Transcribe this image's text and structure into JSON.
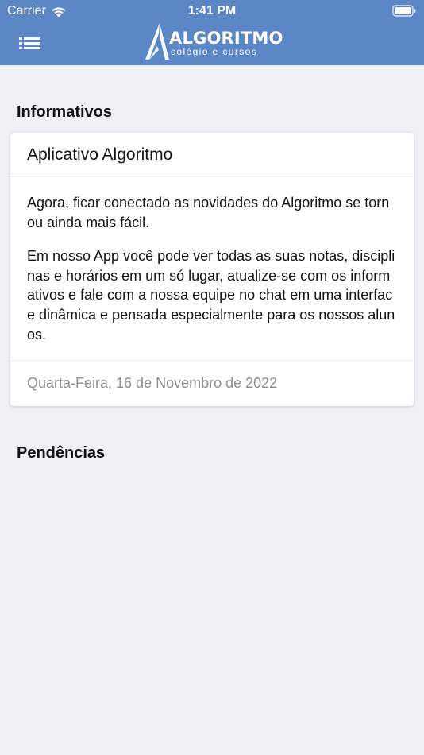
{
  "status_bar": {
    "carrier": "Carrier",
    "time": "1:41 PM"
  },
  "header": {
    "brand_name": "ALGORITMO",
    "brand_tagline": "colégio e cursos",
    "menu_icon": "hamburger-menu-icon",
    "bar_color": "#5b87c7"
  },
  "sections": {
    "informativos_title": "Informativos",
    "pendencias_title": "Pendências"
  },
  "informativo": {
    "title": "Aplicativo Algoritmo",
    "paragraphs": [
      "Agora, ficar conectado as novidades do Algoritmo se tornou ainda mais fácil.",
      "Em nosso App você pode ver todas as suas notas, disciplinas e horários em um só lugar, atualize-se com os informativos e fale com a nossa equipe no chat em uma interface dinâmica e pensada especialmente para os nossos alunos."
    ],
    "date": "Quarta-Feira, 16 de Novembro de 2022"
  }
}
